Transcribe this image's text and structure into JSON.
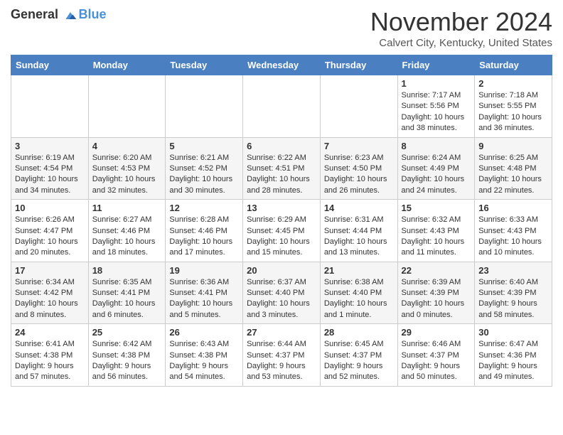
{
  "header": {
    "logo_general": "General",
    "logo_blue": "Blue",
    "month_title": "November 2024",
    "location": "Calvert City, Kentucky, United States"
  },
  "days_of_week": [
    "Sunday",
    "Monday",
    "Tuesday",
    "Wednesday",
    "Thursday",
    "Friday",
    "Saturday"
  ],
  "weeks": [
    [
      {
        "day": "",
        "info": ""
      },
      {
        "day": "",
        "info": ""
      },
      {
        "day": "",
        "info": ""
      },
      {
        "day": "",
        "info": ""
      },
      {
        "day": "",
        "info": ""
      },
      {
        "day": "1",
        "info": "Sunrise: 7:17 AM\nSunset: 5:56 PM\nDaylight: 10 hours and 38 minutes."
      },
      {
        "day": "2",
        "info": "Sunrise: 7:18 AM\nSunset: 5:55 PM\nDaylight: 10 hours and 36 minutes."
      }
    ],
    [
      {
        "day": "3",
        "info": "Sunrise: 6:19 AM\nSunset: 4:54 PM\nDaylight: 10 hours and 34 minutes."
      },
      {
        "day": "4",
        "info": "Sunrise: 6:20 AM\nSunset: 4:53 PM\nDaylight: 10 hours and 32 minutes."
      },
      {
        "day": "5",
        "info": "Sunrise: 6:21 AM\nSunset: 4:52 PM\nDaylight: 10 hours and 30 minutes."
      },
      {
        "day": "6",
        "info": "Sunrise: 6:22 AM\nSunset: 4:51 PM\nDaylight: 10 hours and 28 minutes."
      },
      {
        "day": "7",
        "info": "Sunrise: 6:23 AM\nSunset: 4:50 PM\nDaylight: 10 hours and 26 minutes."
      },
      {
        "day": "8",
        "info": "Sunrise: 6:24 AM\nSunset: 4:49 PM\nDaylight: 10 hours and 24 minutes."
      },
      {
        "day": "9",
        "info": "Sunrise: 6:25 AM\nSunset: 4:48 PM\nDaylight: 10 hours and 22 minutes."
      }
    ],
    [
      {
        "day": "10",
        "info": "Sunrise: 6:26 AM\nSunset: 4:47 PM\nDaylight: 10 hours and 20 minutes."
      },
      {
        "day": "11",
        "info": "Sunrise: 6:27 AM\nSunset: 4:46 PM\nDaylight: 10 hours and 18 minutes."
      },
      {
        "day": "12",
        "info": "Sunrise: 6:28 AM\nSunset: 4:46 PM\nDaylight: 10 hours and 17 minutes."
      },
      {
        "day": "13",
        "info": "Sunrise: 6:29 AM\nSunset: 4:45 PM\nDaylight: 10 hours and 15 minutes."
      },
      {
        "day": "14",
        "info": "Sunrise: 6:31 AM\nSunset: 4:44 PM\nDaylight: 10 hours and 13 minutes."
      },
      {
        "day": "15",
        "info": "Sunrise: 6:32 AM\nSunset: 4:43 PM\nDaylight: 10 hours and 11 minutes."
      },
      {
        "day": "16",
        "info": "Sunrise: 6:33 AM\nSunset: 4:43 PM\nDaylight: 10 hours and 10 minutes."
      }
    ],
    [
      {
        "day": "17",
        "info": "Sunrise: 6:34 AM\nSunset: 4:42 PM\nDaylight: 10 hours and 8 minutes."
      },
      {
        "day": "18",
        "info": "Sunrise: 6:35 AM\nSunset: 4:41 PM\nDaylight: 10 hours and 6 minutes."
      },
      {
        "day": "19",
        "info": "Sunrise: 6:36 AM\nSunset: 4:41 PM\nDaylight: 10 hours and 5 minutes."
      },
      {
        "day": "20",
        "info": "Sunrise: 6:37 AM\nSunset: 4:40 PM\nDaylight: 10 hours and 3 minutes."
      },
      {
        "day": "21",
        "info": "Sunrise: 6:38 AM\nSunset: 4:40 PM\nDaylight: 10 hours and 1 minute."
      },
      {
        "day": "22",
        "info": "Sunrise: 6:39 AM\nSunset: 4:39 PM\nDaylight: 10 hours and 0 minutes."
      },
      {
        "day": "23",
        "info": "Sunrise: 6:40 AM\nSunset: 4:39 PM\nDaylight: 9 hours and 58 minutes."
      }
    ],
    [
      {
        "day": "24",
        "info": "Sunrise: 6:41 AM\nSunset: 4:38 PM\nDaylight: 9 hours and 57 minutes."
      },
      {
        "day": "25",
        "info": "Sunrise: 6:42 AM\nSunset: 4:38 PM\nDaylight: 9 hours and 56 minutes."
      },
      {
        "day": "26",
        "info": "Sunrise: 6:43 AM\nSunset: 4:38 PM\nDaylight: 9 hours and 54 minutes."
      },
      {
        "day": "27",
        "info": "Sunrise: 6:44 AM\nSunset: 4:37 PM\nDaylight: 9 hours and 53 minutes."
      },
      {
        "day": "28",
        "info": "Sunrise: 6:45 AM\nSunset: 4:37 PM\nDaylight: 9 hours and 52 minutes."
      },
      {
        "day": "29",
        "info": "Sunrise: 6:46 AM\nSunset: 4:37 PM\nDaylight: 9 hours and 50 minutes."
      },
      {
        "day": "30",
        "info": "Sunrise: 6:47 AM\nSunset: 4:36 PM\nDaylight: 9 hours and 49 minutes."
      }
    ]
  ]
}
